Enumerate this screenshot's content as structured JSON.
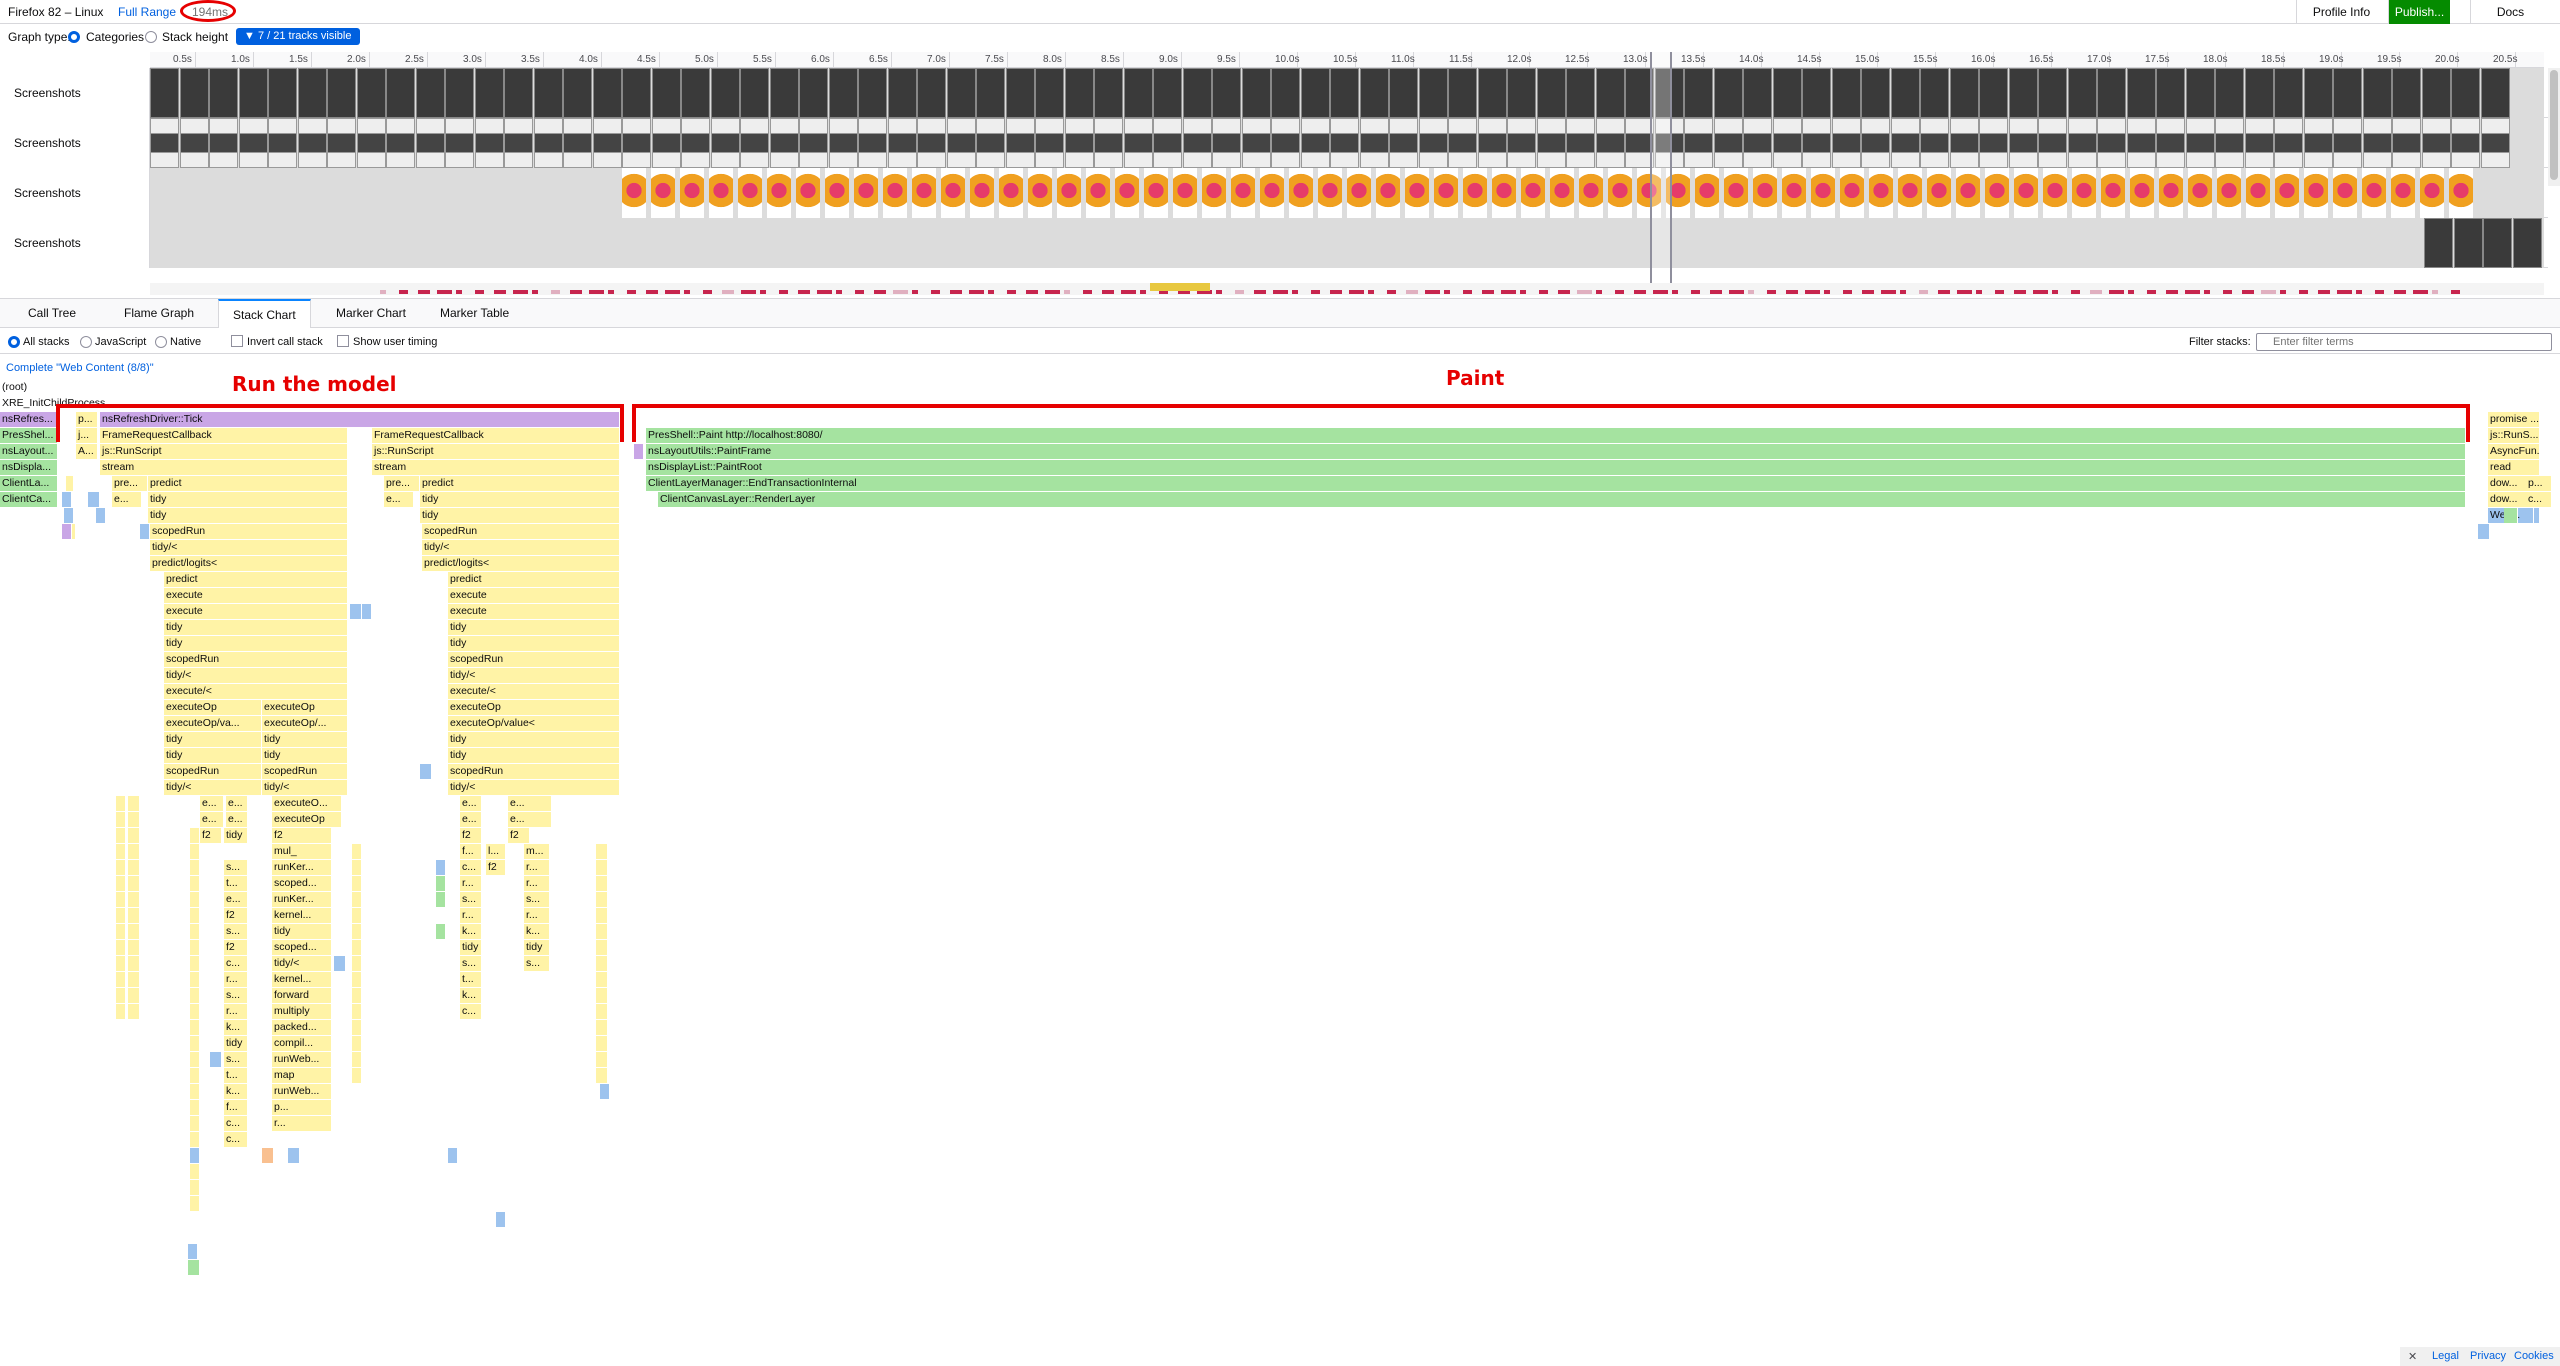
{
  "topbar": {
    "title": "Firefox 82 – Linux",
    "full_range": "Full Range",
    "range_duration": "194ms",
    "profile_info": "Profile Info",
    "publish": "Publish...",
    "docs": "Docs"
  },
  "graph_type": {
    "label": "Graph type:",
    "categories": "Categories",
    "stack_height": "Stack height",
    "tracks_badge": "7 / 21 tracks visible"
  },
  "ruler": [
    "0.5s",
    "1.0s",
    "1.5s",
    "2.0s",
    "2.5s",
    "3.0s",
    "3.5s",
    "4.0s",
    "4.5s",
    "5.0s",
    "5.5s",
    "6.0s",
    "6.5s",
    "7.0s",
    "7.5s",
    "8.0s",
    "8.5s",
    "9.0s",
    "9.5s",
    "10.0s",
    "10.5s",
    "11.0s",
    "11.5s",
    "12.0s",
    "12.5s",
    "13.0s",
    "13.5s",
    "14.0s",
    "14.5s",
    "15.0s",
    "15.5s",
    "16.0s",
    "16.5s",
    "17.0s",
    "17.5s",
    "18.0s",
    "18.5s",
    "19.0s",
    "19.5s",
    "20.0s",
    "20.5s"
  ],
  "tracks": [
    "Screenshots",
    "Screenshots",
    "Screenshots",
    "Screenshots"
  ],
  "tabs": [
    "Call Tree",
    "Flame Graph",
    "Stack Chart",
    "Marker Chart",
    "Marker Table"
  ],
  "settings": {
    "all_stacks": "All stacks",
    "javascript": "JavaScript",
    "native": "Native",
    "invert": "Invert call stack",
    "user_timing": "Show user timing",
    "filter_label": "Filter stacks:",
    "filter_placeholder": "Enter filter terms"
  },
  "breadcrumb": "Complete \"Web Content (8/8)\"",
  "annotations": {
    "left": "Run the model",
    "right": "Paint"
  },
  "stack": {
    "root": "(root)",
    "xre": "XRE_InitChildProcess",
    "left_col": [
      "nsRefres...",
      "PresShel...",
      "nsLayout...",
      "nsDispla...",
      "ClientLa...",
      "ClientCa..."
    ],
    "tick": "nsRefreshDriver::Tick",
    "frc": "FrameRequestCallback",
    "runscript": "js::RunScript",
    "stream": "stream",
    "predict": "predict",
    "tidy": "tidy",
    "scopedrun": "scopedRun",
    "tidylt": "tidy/<",
    "predictlogits": "predict/logits<",
    "execute": "execute",
    "executelt": "execute/<",
    "executeop": "executeOp",
    "executeopval": "executeOp/va...",
    "executeopval2": "executeOp/...",
    "executeopvalue": "executeOp/value<",
    "paint": "PresShell::Paint http://localhost:8080/",
    "paintframe": "nsLayoutUtils::PaintFrame",
    "paintroot": "nsDisplayList::PaintRoot",
    "endtx": "ClientLayerManager::EndTransactionInternal",
    "renderlayer": "ClientCanvasLayer::RenderLayer",
    "right_col": [
      "promise ...",
      "js::RunS...",
      "AsyncFun...",
      "read",
      "dow...",
      "dow...",
      "Web..."
    ],
    "deep_left": [
      "mul_",
      "runKer...",
      "scoped...",
      "runKer...",
      "kernel...",
      "tidy",
      "scoped...",
      "tidy/<",
      "kernel...",
      "forward",
      "multiply",
      "packed...",
      "compil...",
      "runWeb...",
      "map",
      "runWeb...",
      "p...",
      "r..."
    ],
    "misc": [
      "p...",
      "j...",
      "A...",
      "pre...",
      "e...",
      "f2",
      "s...",
      "t...",
      "c...",
      "r...",
      "k...",
      "l...",
      "m...",
      "executeO...",
      "executeOp"
    ]
  },
  "footer": {
    "close": "✕",
    "legal": "Legal",
    "privacy": "Privacy",
    "cookies": "Cookies"
  }
}
